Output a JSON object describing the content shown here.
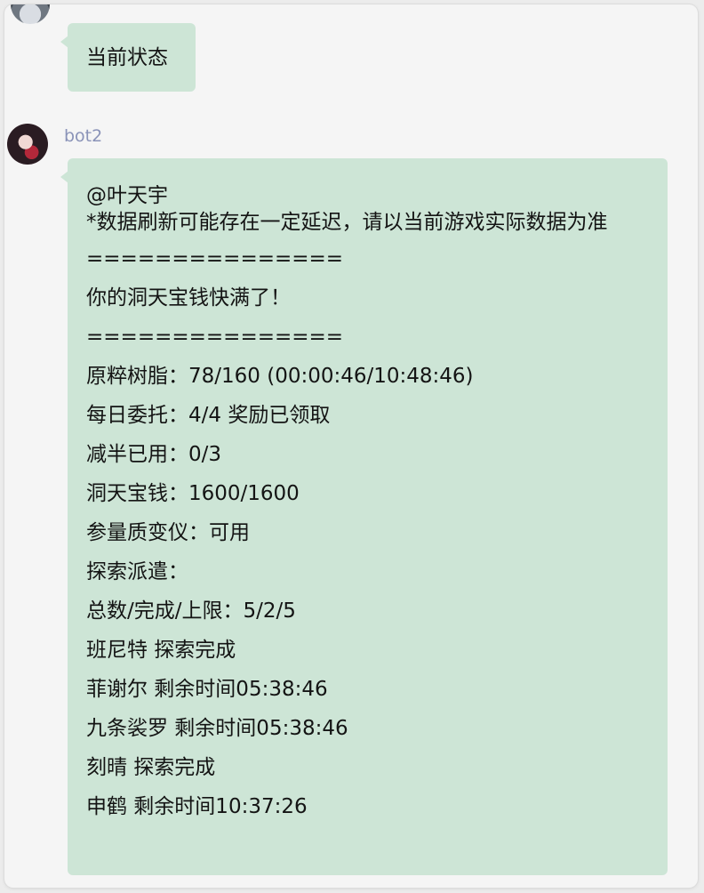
{
  "messages": [
    {
      "text": "当前状态"
    },
    {
      "sender": "bot2",
      "mention": "@叶天宇",
      "notice": "*数据刷新可能存在一定延迟，请以当前游戏实际数据为准",
      "lines": [
        "===============",
        "你的洞天宝钱快满了！",
        "===============",
        "原粹树脂：78/160 (00:00:46/10:48:46)",
        "每日委托：4/4 奖励已领取",
        "减半已用：0/3",
        "洞天宝钱：1600/1600",
        "参量质变仪：可用",
        "探索派遣：",
        "总数/完成/上限：5/2/5",
        "班尼特 探索完成",
        "菲谢尔 剩余时间05:38:46",
        "九条裟罗 剩余时间05:38:46",
        "刻晴 探索完成",
        "申鹤 剩余时间10:37:26"
      ]
    }
  ],
  "colors": {
    "bubble": "#cde5d6",
    "sender_name": "#8a93b8",
    "window_bg": "#f5f5f5"
  }
}
